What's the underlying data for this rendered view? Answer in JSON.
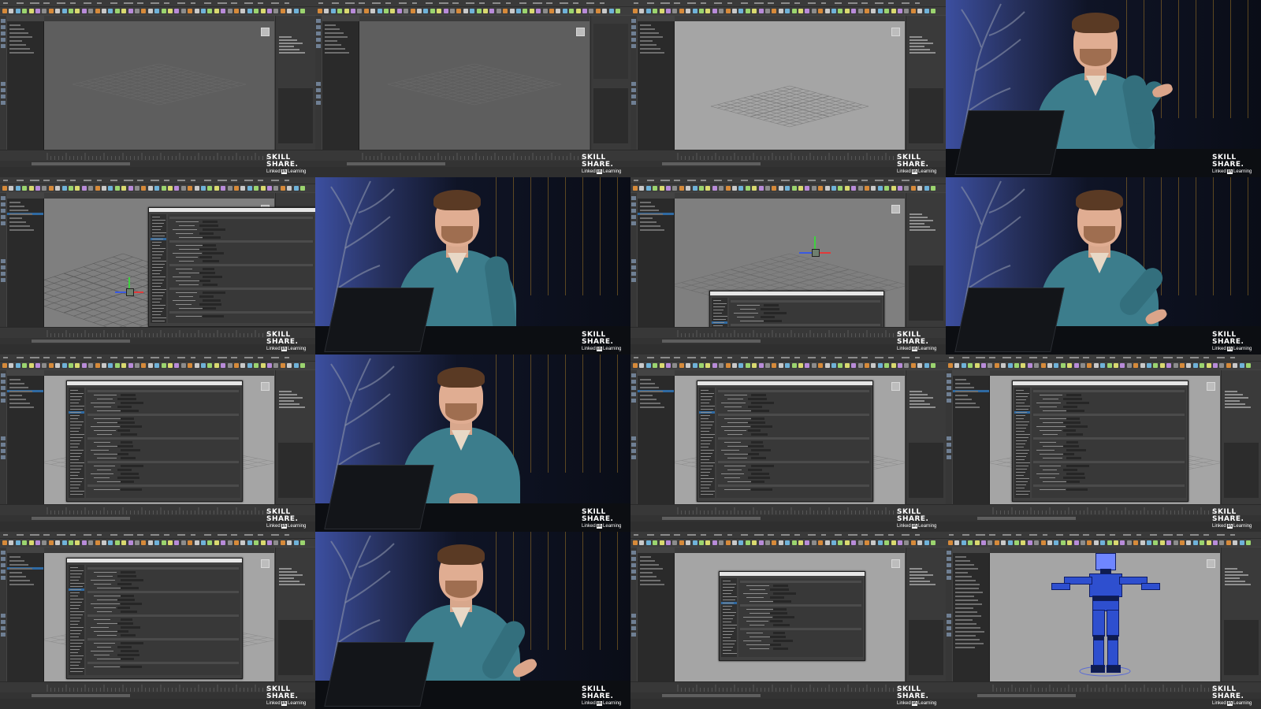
{
  "watermark": {
    "line1": "SKILL",
    "line2": "SHARE.",
    "line3_pre": "Linked",
    "line3_in": "in",
    "line3_post": "Learning"
  },
  "tiles": [
    {
      "kind": "maya",
      "variant": "empty-dark"
    },
    {
      "kind": "maya",
      "variant": "empty-dark-attr"
    },
    {
      "kind": "maya",
      "variant": "grid-light"
    },
    {
      "kind": "instructor",
      "pose": "raised-hand"
    },
    {
      "kind": "maya",
      "variant": "gizmo-dialog"
    },
    {
      "kind": "instructor",
      "pose": "hand-on-table"
    },
    {
      "kind": "maya",
      "variant": "gizmo-bottom-dialog"
    },
    {
      "kind": "instructor",
      "pose": "smile-gesture"
    },
    {
      "kind": "maya",
      "variant": "prefs-dialog"
    },
    {
      "kind": "instructor",
      "pose": "hands-together"
    },
    {
      "kind": "maya",
      "variant": "prefs-dialog-2"
    },
    {
      "kind": "maya",
      "variant": "prefs-dialog-3"
    },
    {
      "kind": "maya",
      "variant": "prefs-dialog-4"
    },
    {
      "kind": "instructor",
      "pose": "open-palm"
    },
    {
      "kind": "maya",
      "variant": "file-dialog"
    },
    {
      "kind": "maya",
      "variant": "robot"
    }
  ],
  "colors": {
    "maya_bg": "#444444",
    "viewport": "#7f7f7f",
    "selection": "#2f6aa3",
    "shirt": "#3c7d8c",
    "robot": "#2e4fcf"
  }
}
